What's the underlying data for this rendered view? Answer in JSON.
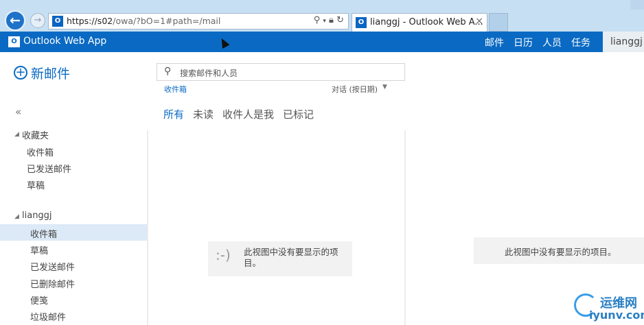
{
  "browser": {
    "address": {
      "url_host": "https://s02",
      "url_path": "/owa/?bO=1#path=/mail",
      "favicon": "outlook-icon",
      "icons": [
        "search-icon",
        "lock-icon",
        "refresh-icon"
      ]
    },
    "tab": {
      "title": "lianggj - Outlook Web A...",
      "close": "×"
    }
  },
  "app": {
    "title": "Outlook Web App",
    "nav": [
      "邮件",
      "日历",
      "人员",
      "任务"
    ],
    "active_nav": "邮件",
    "user": "lianggj",
    "accent": "#0a6ac3"
  },
  "sidebar": {
    "new_mail": "新邮件",
    "collapse": "«",
    "favorites": {
      "label": "收藏夹",
      "items": [
        "收件箱",
        "已发送邮件",
        "草稿"
      ]
    },
    "account": {
      "label": "lianggj",
      "items": [
        "收件箱",
        "草稿",
        "已发送邮件",
        "已删除邮件",
        "便笺",
        "垃圾邮件"
      ],
      "selected": "收件箱"
    }
  },
  "list": {
    "search_placeholder": "搜索邮件和人员",
    "folder": "收件箱",
    "sort": "对话 (按日期)",
    "filters": [
      "所有",
      "未读",
      "收件人是我",
      "已标记"
    ],
    "active_filter": "所有",
    "empty_face": ":-)",
    "empty_text": "此视图中没有要显示的项目。"
  },
  "reading_pane": {
    "empty_text": "此视图中没有要显示的项目。"
  },
  "watermark": {
    "cn": "运维网",
    "en": "iyunv.com"
  }
}
